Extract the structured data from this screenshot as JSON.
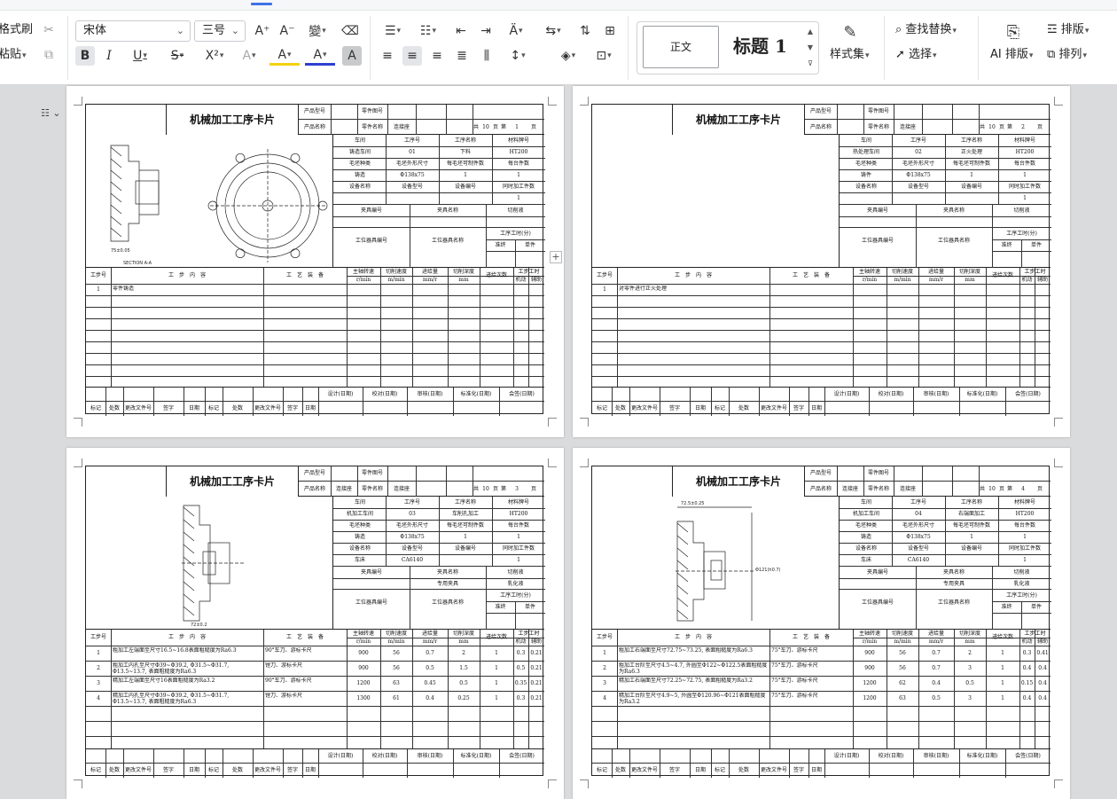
{
  "ribbon": {
    "clipboard": {
      "format_painter": "格式刷",
      "paste": "粘贴"
    },
    "font": {
      "name": "宋体",
      "size": "三号",
      "pinyin": "變",
      "bold": "B",
      "italic": "I",
      "underline": "U",
      "strike": "S",
      "superscript": "X²",
      "shade": "A",
      "highlight": "A",
      "color": "A",
      "char_shade": "A",
      "grow": "A⁺",
      "shrink": "A⁻"
    },
    "styles": {
      "normal": "正文",
      "heading1": "标题 1",
      "style_set": "样式集"
    },
    "find": {
      "find_replace": "查找替换",
      "select": "选择"
    },
    "ai": {
      "ai_layout": "AI 排版",
      "layout": "排版",
      "arrange": "排列"
    },
    "accent": "#3f73e6"
  },
  "cards": [
    {
      "title": "机械加工工序卡片",
      "product_model_label": "产品型号",
      "product_name_label": "产品名称",
      "product_name": "",
      "part_no_label": "零件图号",
      "part_name_label": "零件名称",
      "part_name": "连接座",
      "total_pages": "10",
      "page": "1",
      "workshop": "铸造车间",
      "op_no": "01",
      "op_name": "下料",
      "material": "HT200",
      "blank_type": "铸造",
      "blank_size": "Φ138x75",
      "per_blank": "1",
      "per_machine": "1",
      "equip_name": "",
      "equip_model": "",
      "equip_no": "",
      "simul": "1",
      "fixture_no": "",
      "fixture_name": "",
      "coolant": "",
      "station_tool_no": "",
      "station_tool_name": "",
      "time_total": "",
      "time_unit": "",
      "steps": [
        {
          "no": "1",
          "content": "零件铸造",
          "equip": "",
          "speed": "",
          "cut_speed": "",
          "feed": "",
          "depth": "",
          "passes": "",
          "t_machine": "",
          "t_aux": ""
        }
      ]
    },
    {
      "title": "机械加工工序卡片",
      "product_model_label": "产品型号",
      "product_name_label": "产品名称",
      "product_name": "",
      "part_no_label": "零件图号",
      "part_name_label": "零件名称",
      "part_name": "连接座",
      "total_pages": "10",
      "page": "2",
      "workshop": "热处理车间",
      "op_no": "02",
      "op_name": "正火处理",
      "material": "HT200",
      "blank_type": "铸件",
      "blank_size": "Φ138x75",
      "per_blank": "1",
      "per_machine": "1",
      "equip_name": "",
      "equip_model": "",
      "equip_no": "",
      "simul": "1",
      "fixture_no": "",
      "fixture_name": "",
      "coolant": "",
      "station_tool_no": "",
      "station_tool_name": "",
      "time_total": "",
      "time_unit": "",
      "steps": [
        {
          "no": "1",
          "content": "对零件进行正火处理",
          "equip": "",
          "speed": "",
          "cut_speed": "",
          "feed": "",
          "depth": "",
          "passes": "",
          "t_machine": "",
          "t_aux": ""
        }
      ]
    },
    {
      "title": "机械加工工序卡片",
      "product_model_label": "产品型号",
      "product_name_label": "产品名称",
      "product_name": "连接座",
      "part_no_label": "零件图号",
      "part_name_label": "零件名称",
      "part_name": "连接座",
      "total_pages": "10",
      "page": "3",
      "workshop": "机加工车间",
      "op_no": "03",
      "op_name": "车削孔加工",
      "material": "HT200",
      "blank_type": "铸造",
      "blank_size": "Φ138x75",
      "per_blank": "1",
      "per_machine": "1",
      "equip_name": "车床",
      "equip_model": "CA6140",
      "equip_no": "",
      "simul": "1",
      "fixture_no": "",
      "fixture_name": "专用夹具",
      "coolant": "乳化液",
      "station_tool_no": "",
      "station_tool_name": "",
      "time_total": "",
      "time_unit": "",
      "steps": [
        {
          "no": "1",
          "content": "粗加工左端面至尺寸16.5~16.8表面粗糙度为Ra6.3",
          "equip": "90°车刀、游标卡尺",
          "speed": "900",
          "cut_speed": "56",
          "feed": "0.7",
          "depth": "2",
          "passes": "1",
          "t_machine": "0.3",
          "t_aux": "0.21"
        },
        {
          "no": "2",
          "content": "粗加工内孔至尺寸Φ39~Φ39.2, Φ31.5~Φ31.7, Φ13.5~13.7, 表面粗糙度为Ra6.3",
          "equip": "镗刀、游标卡尺",
          "speed": "900",
          "cut_speed": "56",
          "feed": "0.5",
          "depth": "1.5",
          "passes": "1",
          "t_machine": "0.5",
          "t_aux": "0.21"
        },
        {
          "no": "3",
          "content": "精加工左端面至尺寸16表面粗糙度为Ra3.2",
          "equip": "90°车刀、游标卡尺",
          "speed": "1200",
          "cut_speed": "63",
          "feed": "0.45",
          "depth": "0.5",
          "passes": "1",
          "t_machine": "0.35",
          "t_aux": "0.21"
        },
        {
          "no": "4",
          "content": "精加工内孔至尺寸Φ39~Φ39.2, Φ31.5~Φ31.7, Φ13.5~13.7, 表面粗糙度为Ra6.3",
          "equip": "镗刀、游标卡尺",
          "speed": "1300",
          "cut_speed": "61",
          "feed": "0.4",
          "depth": "0.25",
          "passes": "1",
          "t_machine": "0.3",
          "t_aux": "0.21"
        }
      ]
    },
    {
      "title": "机械加工工序卡片",
      "product_model_label": "产品型号",
      "product_name_label": "产品名称",
      "product_name": "连接座",
      "part_no_label": "零件图号",
      "part_name_label": "零件名称",
      "part_name": "连接座",
      "total_pages": "10",
      "page": "4",
      "workshop": "机加工车间",
      "op_no": "04",
      "op_name": "右端面加工",
      "material": "HT200",
      "blank_type": "铸造",
      "blank_size": "Φ138x75",
      "per_blank": "1",
      "per_machine": "1",
      "equip_name": "车床",
      "equip_model": "CA6140",
      "equip_no": "",
      "simul": "1",
      "fixture_no": "",
      "fixture_name": "专用夹具",
      "coolant": "乳化液",
      "station_tool_no": "",
      "station_tool_name": "",
      "time_total": "",
      "time_unit": "",
      "steps": [
        {
          "no": "1",
          "content": "粗加工右端面至尺寸72.75~73.25, 表面粗糙度为Ra6.3",
          "equip": "75°车刀、游标卡尺",
          "speed": "900",
          "cut_speed": "56",
          "feed": "0.7",
          "depth": "2",
          "passes": "1",
          "t_machine": "0.3",
          "t_aux": "0.41"
        },
        {
          "no": "2",
          "content": "粗加工台阶至尺寸4.5~4.7, 外圆至Φ122~Φ122.5表面粗糙度为Ra6.3",
          "equip": "75°车刀、游标卡尺",
          "speed": "900",
          "cut_speed": "56",
          "feed": "0.7",
          "depth": "3",
          "passes": "1",
          "t_machine": "0.4",
          "t_aux": "0.4"
        },
        {
          "no": "3",
          "content": "精加工右端面至尺寸72.25~72.75, 表面粗糙度为Ra3.2",
          "equip": "75°车刀、游标卡尺",
          "speed": "1200",
          "cut_speed": "62",
          "feed": "0.4",
          "depth": "0.5",
          "passes": "1",
          "t_machine": "0.15",
          "t_aux": "0.4"
        },
        {
          "no": "4",
          "content": "精加工台阶至尺寸4.9~5, 外圆至Φ120.96~Φ121表面粗糙度为Ra3.2",
          "equip": "75°车刀、游标卡尺",
          "speed": "1200",
          "cut_speed": "63",
          "feed": "0.5",
          "depth": "3",
          "passes": "1",
          "t_machine": "0.4",
          "t_aux": "0.4"
        }
      ]
    }
  ],
  "labels": {
    "workshop": "车间",
    "op_no": "工序号",
    "op_name": "工序名称",
    "material": "材料牌号",
    "blank_type": "毛坯种类",
    "blank_size": "毛坯外形尺寸",
    "per_blank": "每毛坯可制件数",
    "per_machine": "每台件数",
    "equip_name": "设备名称",
    "equip_model": "设备型号",
    "equip_no": "设备编号",
    "simul": "同时加工件数",
    "fixture_no": "夹具编号",
    "fixture_name": "夹具名称",
    "coolant": "切削液",
    "station_tool_no": "工位器具编号",
    "station_tool_name": "工位器具名称",
    "time": "工序工时(分)",
    "time_total": "准终",
    "time_unit": "单件",
    "step_no": "工步号",
    "step_content": "工　步　内　容",
    "step_equip": "工　艺　装　备",
    "speed": "主轴转速",
    "cut_speed": "切削速度",
    "feed": "进给量",
    "depth": "切削深度",
    "passes": "进给次数",
    "step_time": "工步工时",
    "t_machine": "机动",
    "t_aux": "辅助",
    "u_speed": "r/min",
    "u_cut": "m/min",
    "u_feed": "mm/r",
    "u_depth": "mm",
    "total": "共",
    "page": "第",
    "page_unit": "页",
    "design": "设计(日期)",
    "check": "校对(日期)",
    "review": "审核(日期)",
    "standard": "标准化(日期)",
    "sign": "会签(日期)",
    "mark": "标记",
    "place": "处数",
    "doc": "更改文件号",
    "signature": "签字",
    "date": "日期",
    "section": "SECTION A-A"
  },
  "sketch_dims": {
    "c1_width": "75±0.05",
    "c3_width": "72±0.2",
    "c4_top": "72.5±0.25",
    "c4_dia": "Φ121(h0.7)"
  }
}
